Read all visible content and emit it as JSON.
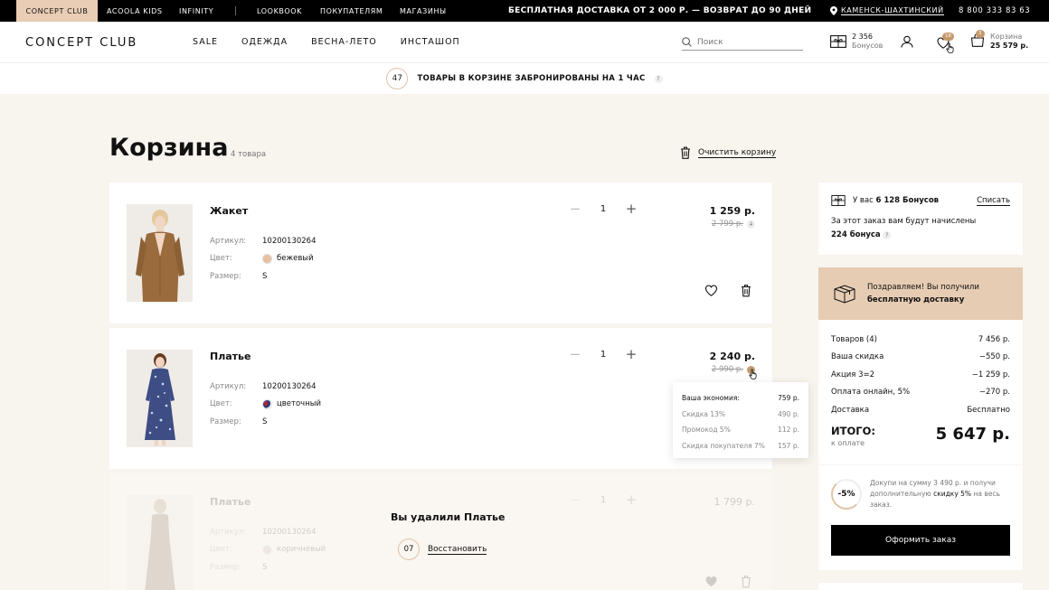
{
  "topbar": {
    "brands": [
      "CONCEPT CLUB",
      "ACOOLA KIDS",
      "INFINITY"
    ],
    "links": [
      "LOOKBOOK",
      "ПОКУПАТЕЛЯМ",
      "МАГАЗИНЫ"
    ],
    "promo": "БЕСПЛАТНАЯ ДОСТАВКА ОТ 2 000 Р. — ВОЗВРАТ ДО 90 ДНЕЙ",
    "city": "КАМЕНСК-ШАХТИНСКИЙ",
    "phone": "8 800 333 83 63"
  },
  "header": {
    "logo": "CONCEPT CLUB",
    "nav": [
      "SALE",
      "ОДЕЖДА",
      "ВЕСНА-ЛЕТО",
      "ИНСТАШОП"
    ],
    "search_placeholder": "Поиск",
    "bonus_value": "2 356",
    "bonus_label": "Бонусов",
    "fav_badge": "18",
    "cart_badge": "3",
    "cart_label": "Корзина",
    "cart_total": "25 579 р."
  },
  "reserve": {
    "timer": "47",
    "text": "ТОВАРЫ В КОРЗИНЕ ЗАБРОНИРОВАНЫ НА 1 ЧАС",
    "q": "?"
  },
  "page": {
    "title": "Корзина",
    "count": "4 товара",
    "clear": "Очистить корзину"
  },
  "labels": {
    "article": "Артикул:",
    "color": "Цвет:",
    "size": "Размер:",
    "plus": "+",
    "minus": "−"
  },
  "items": [
    {
      "name": "Жакет",
      "article": "10200130264",
      "color": "бежевый",
      "swatch": "#e7c0a1",
      "size": "S",
      "qty": "1",
      "price": "1 259 р.",
      "old_price": "2 799 р."
    },
    {
      "name": "Платье",
      "article": "10200130264",
      "color": "цветочный",
      "swatch": "#b2243a",
      "size": "S",
      "qty": "1",
      "price": "2 240 р.",
      "old_price": "2 990 р."
    },
    {
      "name": "Платье",
      "article": "10200130264",
      "color": "коричневый",
      "swatch": "#b9a99a",
      "size": "S",
      "qty": "1",
      "price": "1 799 р."
    }
  ],
  "deleted": {
    "message": "Вы удалили Платье",
    "timer": "07",
    "restore": "Восстановить"
  },
  "tooltip": {
    "rows": [
      {
        "label": "Ваша экономия:",
        "value": "759 р."
      },
      {
        "label": "Скидка 13%",
        "value": "490 р."
      },
      {
        "label": "Промокод 5%",
        "value": "112 р."
      },
      {
        "label": "Скидка покупателя 7%",
        "value": "157 р."
      }
    ]
  },
  "sidebar": {
    "bonus_prefix": "У вас",
    "bonus_amount": "6 128 Бонусов",
    "writeoff": "Списать",
    "accrue_text": "За этот заказ вам будут начислены",
    "accrue_amount": "224 бонуса",
    "free_ship_1": "Поздравляем! Вы получили",
    "free_ship_2": "бесплатную доставку",
    "summary": [
      {
        "label": "Товаров (4)",
        "value": "7 456 р."
      },
      {
        "label": "Ваша скидка",
        "value": "−550 р."
      },
      {
        "label": "Акция 3=2",
        "value": "−1 259 р."
      },
      {
        "label": "Оплата онлайн, 5%",
        "value": "−270 р."
      },
      {
        "label": "Доставка",
        "value": "Бесплатно"
      }
    ],
    "total_label": "ИТОГО:",
    "total_sub": "к оплате",
    "total_value": "5 647 р.",
    "upsell_ring": "-5%",
    "upsell_text_1": "Докупи на сумму 3 490 р. и получи дополнительную",
    "upsell_link": "скидку 5%",
    "upsell_text_2": "на весь заказ.",
    "checkout": "Оформить заказ"
  }
}
